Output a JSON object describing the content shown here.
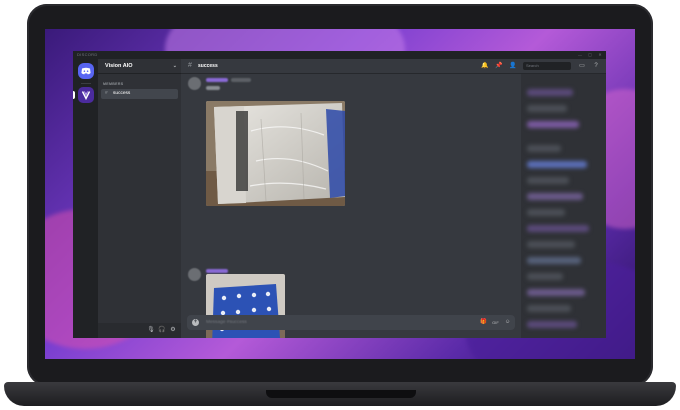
{
  "window": {
    "brand": "DISCORD",
    "controls": [
      "—",
      "▢",
      "✕"
    ]
  },
  "server": {
    "name": "Vision AIO",
    "chevron": "⌄"
  },
  "channels": {
    "category": "MEMBERS",
    "items": [
      {
        "label": "success"
      }
    ]
  },
  "chat": {
    "channel_name": "success",
    "search_placeholder": "Search",
    "input_placeholder": "Message #success"
  },
  "icons": {
    "discord_logo": "discord-logo",
    "hash": "#",
    "bell": "🔔",
    "pin": "📌",
    "members": "👤",
    "inbox": "▭",
    "help": "?",
    "mic": "🎙",
    "headphones": "🎧",
    "settings": "⚙",
    "gift": "🎁",
    "gif": "GIF",
    "emoji": "☺",
    "plus": "+"
  },
  "colors": {
    "discord_bg": "#36393f",
    "sidebar_bg": "#2f3136",
    "rail_bg": "#202225",
    "blurple": "#5865f2",
    "accent_purple": "#7a3fd0"
  }
}
